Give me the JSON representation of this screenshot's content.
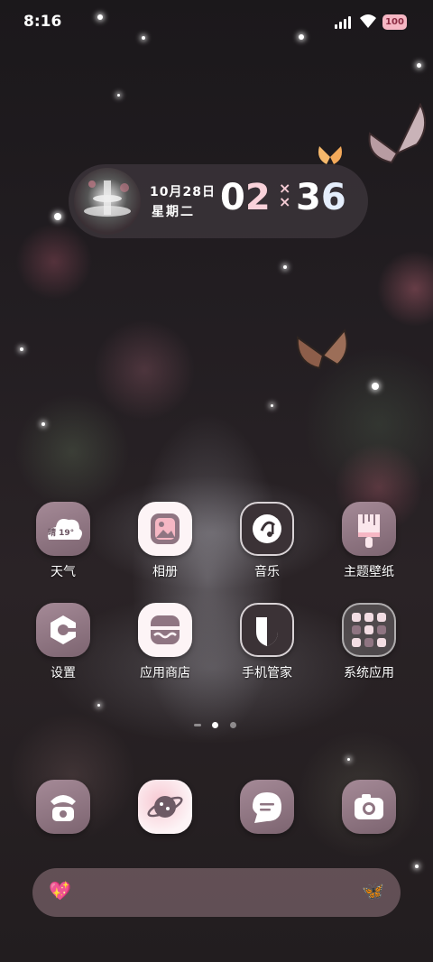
{
  "status_bar": {
    "time": "8:16",
    "battery": "100"
  },
  "clock_widget": {
    "date": "10月28日",
    "weekday": "星期二",
    "hour_digits": [
      "0",
      "2"
    ],
    "minute_digits": [
      "3",
      "6"
    ],
    "separator": "×\n×"
  },
  "apps": [
    {
      "label": "天气",
      "weather_text": "晴 19°"
    },
    {
      "label": "相册"
    },
    {
      "label": "音乐"
    },
    {
      "label": "主题壁纸"
    },
    {
      "label": "设置"
    },
    {
      "label": "应用商店"
    },
    {
      "label": "手机管家"
    },
    {
      "label": "系统应用"
    }
  ],
  "pager": {
    "pages": 3,
    "current": 2
  },
  "dock": [
    "phone",
    "browser",
    "messages",
    "camera"
  ],
  "search_bar": {
    "left_emoji": "💖",
    "right_emoji": "🦋"
  },
  "colors": {
    "accent_pink": "#f6b7c4",
    "icon_mauve": "#8f7582",
    "widget_bg": "#3c343a"
  }
}
